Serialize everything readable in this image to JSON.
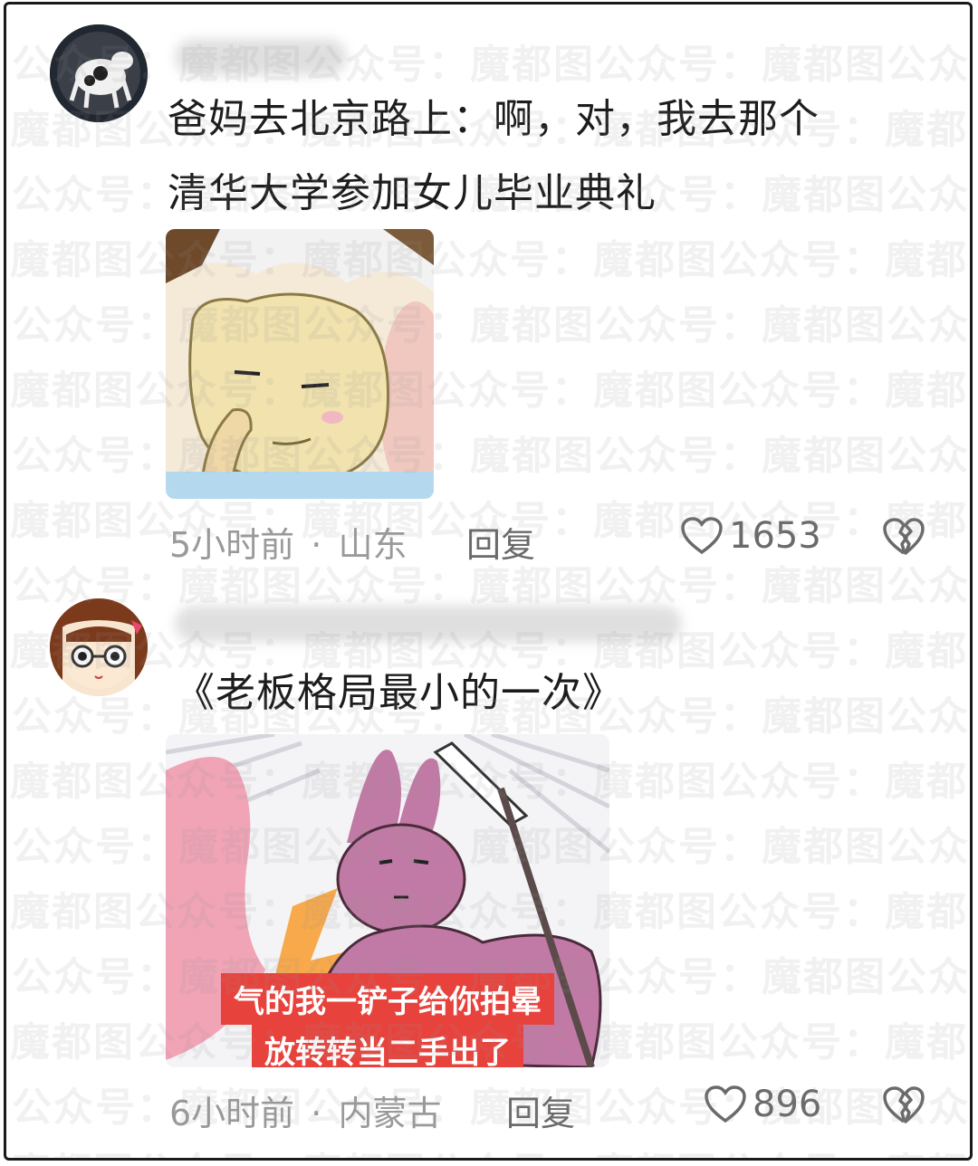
{
  "comments": [
    {
      "text_lines": [
        "爸妈去北京路上：啊，对，我去那个",
        "清华大学参加女儿毕业典礼"
      ],
      "time": "5小时前",
      "location": "山东",
      "reply_label": "回复",
      "likes": "1653"
    },
    {
      "text_lines": [
        "《老板格局最小的一次》"
      ],
      "time": "6小时前",
      "location": "内蒙古",
      "reply_label": "回复",
      "likes": "896",
      "image_caption": [
        "气的我一铲子给你拍晕",
        "放转转当二手出了"
      ]
    }
  ],
  "watermark": {
    "left": "公众号：",
    "right": "魔都图"
  },
  "meta_separator": "·",
  "colors": {
    "text": "#1c1c1c",
    "meta": "#9a9a9a",
    "caption_bg": "#e8423c"
  },
  "icons": [
    "heart-outline-icon",
    "broken-heart-icon"
  ]
}
